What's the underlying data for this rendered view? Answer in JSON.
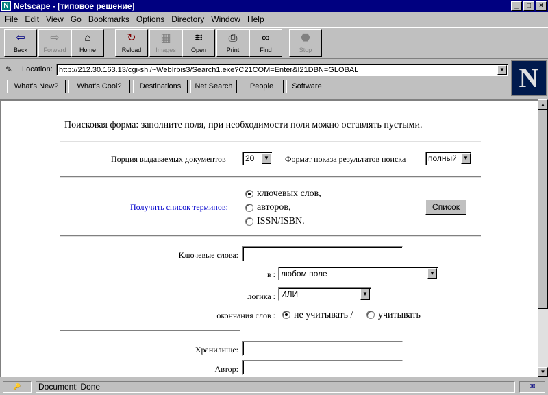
{
  "window": {
    "title": "Netscape - [типовое решение]",
    "app_icon": "N"
  },
  "menu": [
    "File",
    "Edit",
    "View",
    "Go",
    "Bookmarks",
    "Options",
    "Directory",
    "Window",
    "Help"
  ],
  "toolbar": {
    "back": "Back",
    "forward": "Forward",
    "home": "Home",
    "reload": "Reload",
    "images": "Images",
    "open": "Open",
    "print": "Print",
    "find": "Find",
    "stop": "Stop"
  },
  "location": {
    "label": "Location:",
    "url": "http://212.30.163.13/cgi-shl/~WebIrbis3/Search1.exe?C21COM=Enter&I21DBN=GLOBAL"
  },
  "directory_buttons": [
    "What's New?",
    "What's Cool?",
    "Destinations",
    "Net Search",
    "People",
    "Software"
  ],
  "logo_letter": "N",
  "form": {
    "intro": "Поисковая форма: заполните поля, при необходимости поля можно оставлять пустыми.",
    "portion_label": "Порция выдаваемых документов",
    "portion_value": "20",
    "format_label": "Формат показа результатов поиска",
    "format_value": "полный",
    "terms_link": "Получить список терминов:",
    "terms_options": [
      "ключевых слов,",
      "авторов,",
      "ISSN/ISBN."
    ],
    "list_button": "Список",
    "keywords_label": "Ключевые слова:",
    "in_label": "в :",
    "in_value": "любом поле",
    "logic_label": "логика :",
    "logic_value": "ИЛИ",
    "endings_label": "окончания слов :",
    "endings_ignore": "не учитывать /",
    "endings_consider": "учитывать",
    "storage_label": "Хранилище:",
    "author_label": "Автор:"
  },
  "status": {
    "security": "🔑",
    "text": "Document: Done",
    "mail": "✉"
  }
}
